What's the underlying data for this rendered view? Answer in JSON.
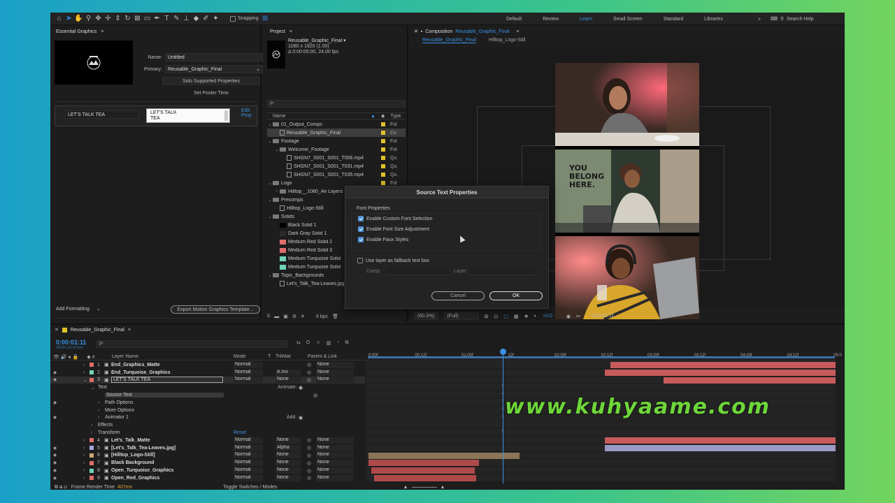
{
  "toolbar": {
    "snapping": "Snapping",
    "workspaces": [
      "Default",
      "Review",
      "Learn",
      "Small Screen",
      "Standard",
      "Libraries"
    ],
    "active_workspace": "Learn",
    "search_help": "Search Help"
  },
  "essential_graphics": {
    "title": "Essential Graphics",
    "name_label": "Name:",
    "name_value": "Untitled",
    "primary_label": "Primary:",
    "primary_value": "Reusable_Graphic_Final",
    "solo_button": "Solo Supported Properties",
    "poster_button": "Set Poster Time",
    "prop_label": "LET'S TALK TEA",
    "prop_value_line1": "LET'S TALK",
    "prop_value_line2": "TEA",
    "edit_props": "Edit Prop",
    "add_formatting": "Add Formatting",
    "export_button": "Export Motion Graphics Template..."
  },
  "project": {
    "title": "Project",
    "item_name": "Reusable_Graphic_Final",
    "item_dims": "1080 x 1920 (1.00)",
    "item_duration": "Δ 0:00:05:00, 24.00 fps",
    "search_placeholder": "ρ-",
    "col_name": "Name",
    "col_type": "Type",
    "bpc": "8 bpc",
    "rows": [
      {
        "indent": 0,
        "kind": "folder",
        "open": true,
        "name": "01_Output_Comps",
        "label": "#e0c22a",
        "type": "Fol"
      },
      {
        "indent": 1,
        "kind": "comp",
        "name": "Reusable_Graphic_Final",
        "label": "#e0c22a",
        "type": "Co",
        "selected": true
      },
      {
        "indent": 0,
        "kind": "folder",
        "open": true,
        "name": "Footage",
        "label": "#e0c22a",
        "type": "Fol"
      },
      {
        "indent": 1,
        "kind": "folder",
        "open": true,
        "name": "Welcome_Footage",
        "label": "#e0c22a",
        "type": "Fol"
      },
      {
        "indent": 2,
        "kind": "file",
        "name": "SHGN7_S001_S001_T006.mp4",
        "label": "#e0c22a",
        "type": "Qu"
      },
      {
        "indent": 2,
        "kind": "file",
        "name": "SHGN7_S001_S001_T031.mp4",
        "label": "#e0c22a",
        "type": "Qu"
      },
      {
        "indent": 2,
        "kind": "file",
        "name": "SHGN7_S001_S001_T035.mp4",
        "label": "#e0c22a",
        "type": "Qu"
      },
      {
        "indent": 0,
        "kind": "folder",
        "open": true,
        "name": "Logo",
        "label": "#e0c22a",
        "type": "Fol"
      },
      {
        "indent": 1,
        "kind": "folder",
        "open": false,
        "name": "Hilltop__1080_Ae Layers",
        "label": "#e0c22a",
        "type": "Fol"
      },
      {
        "indent": 0,
        "kind": "folder",
        "open": true,
        "name": "Precomps",
        "label": "",
        "type": ""
      },
      {
        "indent": 1,
        "kind": "comp",
        "name": "Hilltop_Logo-Still",
        "label": "",
        "type": ""
      },
      {
        "indent": 0,
        "kind": "folder",
        "open": true,
        "name": "Solids",
        "label": "",
        "type": ""
      },
      {
        "indent": 1,
        "kind": "solid",
        "swatch": "#000000",
        "name": "Black Solid 1",
        "label": "",
        "type": ""
      },
      {
        "indent": 1,
        "kind": "solid",
        "swatch": "#2b2b2b",
        "name": "Dark Gray Solid 1",
        "label": "",
        "type": ""
      },
      {
        "indent": 1,
        "kind": "solid",
        "swatch": "#e06c6c",
        "name": "Medium Red Solid 2",
        "label": "",
        "type": ""
      },
      {
        "indent": 1,
        "kind": "solid",
        "swatch": "#e06c6c",
        "name": "Medium Red Solid 3",
        "label": "",
        "type": ""
      },
      {
        "indent": 1,
        "kind": "solid",
        "swatch": "#6fd3b6",
        "name": "Medium Turquoise Solid",
        "label": "",
        "type": ""
      },
      {
        "indent": 1,
        "kind": "solid",
        "swatch": "#6fd3b6",
        "name": "Medium Turquoise Solid",
        "label": "",
        "type": ""
      },
      {
        "indent": 0,
        "kind": "folder",
        "open": true,
        "name": "Topic_Backgrounds",
        "label": "",
        "type": ""
      },
      {
        "indent": 1,
        "kind": "file",
        "name": "Let's_Talk_Tea-Leaves.jpg",
        "label": "",
        "type": ""
      }
    ]
  },
  "composition": {
    "title_prefix": "Composition",
    "title_comp": "Reusable_Graphic_Final",
    "tabs": [
      "Reusable_Graphic_Final",
      "Hilltop_Logo-Still"
    ],
    "zoom": "(60.3%)",
    "quality": "(Full)",
    "exposure": "+0.0",
    "timecode": "0:00:01:11"
  },
  "dialog": {
    "title": "Source Text Properties",
    "group_label": "Font Properties",
    "options": [
      {
        "label": "Enable Custom Font Selection",
        "checked": true
      },
      {
        "label": "Enable Font Size Adjustment",
        "checked": true
      },
      {
        "label": "Enable Faux Styles",
        "checked": true
      }
    ],
    "fallback_label": "Use layer as fallback text box",
    "comp_label": "Comp:",
    "layer_label": "Layer:",
    "cancel": "Cancel",
    "ok": "OK"
  },
  "timeline": {
    "comp_tab": "Reusable_Graphic_Final",
    "timecode": "0:00:01:11",
    "timecode_sub": "00035 (24.00 fps)",
    "col_layer_name": "Layer Name",
    "col_mode": "Mode",
    "col_t": "T",
    "col_trkmat": "TrkMat",
    "col_parent": "Parent & Link",
    "ticks": [
      "0:00f",
      "00:12f",
      "01:00f",
      "12f",
      "02:00f",
      "02:12f",
      "03:00f",
      "03:12f",
      "04:00f",
      "04:12f",
      "05:0"
    ],
    "footer_render": "Frame Render Time",
    "footer_ms": "407ms",
    "footer_toggle": "Toggle Switches / Modes",
    "layers": [
      {
        "num": "1",
        "name": "End_Graphics_Matte",
        "color": "#e06c6c",
        "mode": "Normal",
        "trk": "",
        "parent": "None",
        "eye": false,
        "bold": true
      },
      {
        "num": "2",
        "name": "End_Turquoise_Graphics",
        "color": "#6fd3b6",
        "mode": "Normal",
        "trk": "A.Inv",
        "parent": "None",
        "eye": true,
        "bold": true
      },
      {
        "num": "3",
        "name": "LET'S TALK TEA",
        "color": "#e06c6c",
        "mode": "Normal",
        "trk": "None",
        "parent": "None",
        "eye": true,
        "selected": true
      },
      {
        "sub": "Text",
        "level": 1,
        "extra": "Animate:"
      },
      {
        "sub": "Source Text",
        "level": 2,
        "highlight": true
      },
      {
        "sub": "Path Options",
        "level": 2,
        "eye": true
      },
      {
        "sub": "More Options",
        "level": 2
      },
      {
        "sub": "Animator 1",
        "level": 2,
        "eye": true,
        "extra": "Add:"
      },
      {
        "sub": "Effects",
        "level": 1
      },
      {
        "sub": "Transform",
        "level": 1,
        "extra": "Reset"
      },
      {
        "num": "4",
        "name": "Let's_Talk_Matte",
        "color": "#e06c6c",
        "mode": "Normal",
        "trk": "None",
        "parent": "None",
        "eye": false,
        "bold": true
      },
      {
        "num": "5",
        "name": "[Let's_Talk_Tea-Leaves.jpg]",
        "color": "#a7a7e0",
        "mode": "Normal",
        "trk": "Alpha",
        "parent": "None",
        "eye": true,
        "bold": true
      },
      {
        "num": "6",
        "name": "[Hilltop_Logo-Still]",
        "color": "#c9a877",
        "mode": "Normal",
        "trk": "None",
        "parent": "None",
        "eye": true,
        "bold": true
      },
      {
        "num": "7",
        "name": "Black Background",
        "color": "#e06c6c",
        "mode": "Normal",
        "trk": "None",
        "parent": "None",
        "eye": true,
        "bold": true
      },
      {
        "num": "8",
        "name": "Open_Turquoise_Graphics",
        "color": "#6fd3b6",
        "mode": "Normal",
        "trk": "None",
        "parent": "None",
        "eye": true,
        "bold": true
      },
      {
        "num": "9",
        "name": "Open_Red_Graphics",
        "color": "#e06c6c",
        "mode": "Normal",
        "trk": "None",
        "parent": "None",
        "eye": true,
        "bold": true
      }
    ]
  },
  "watermark": "www.kuhyaame.com"
}
